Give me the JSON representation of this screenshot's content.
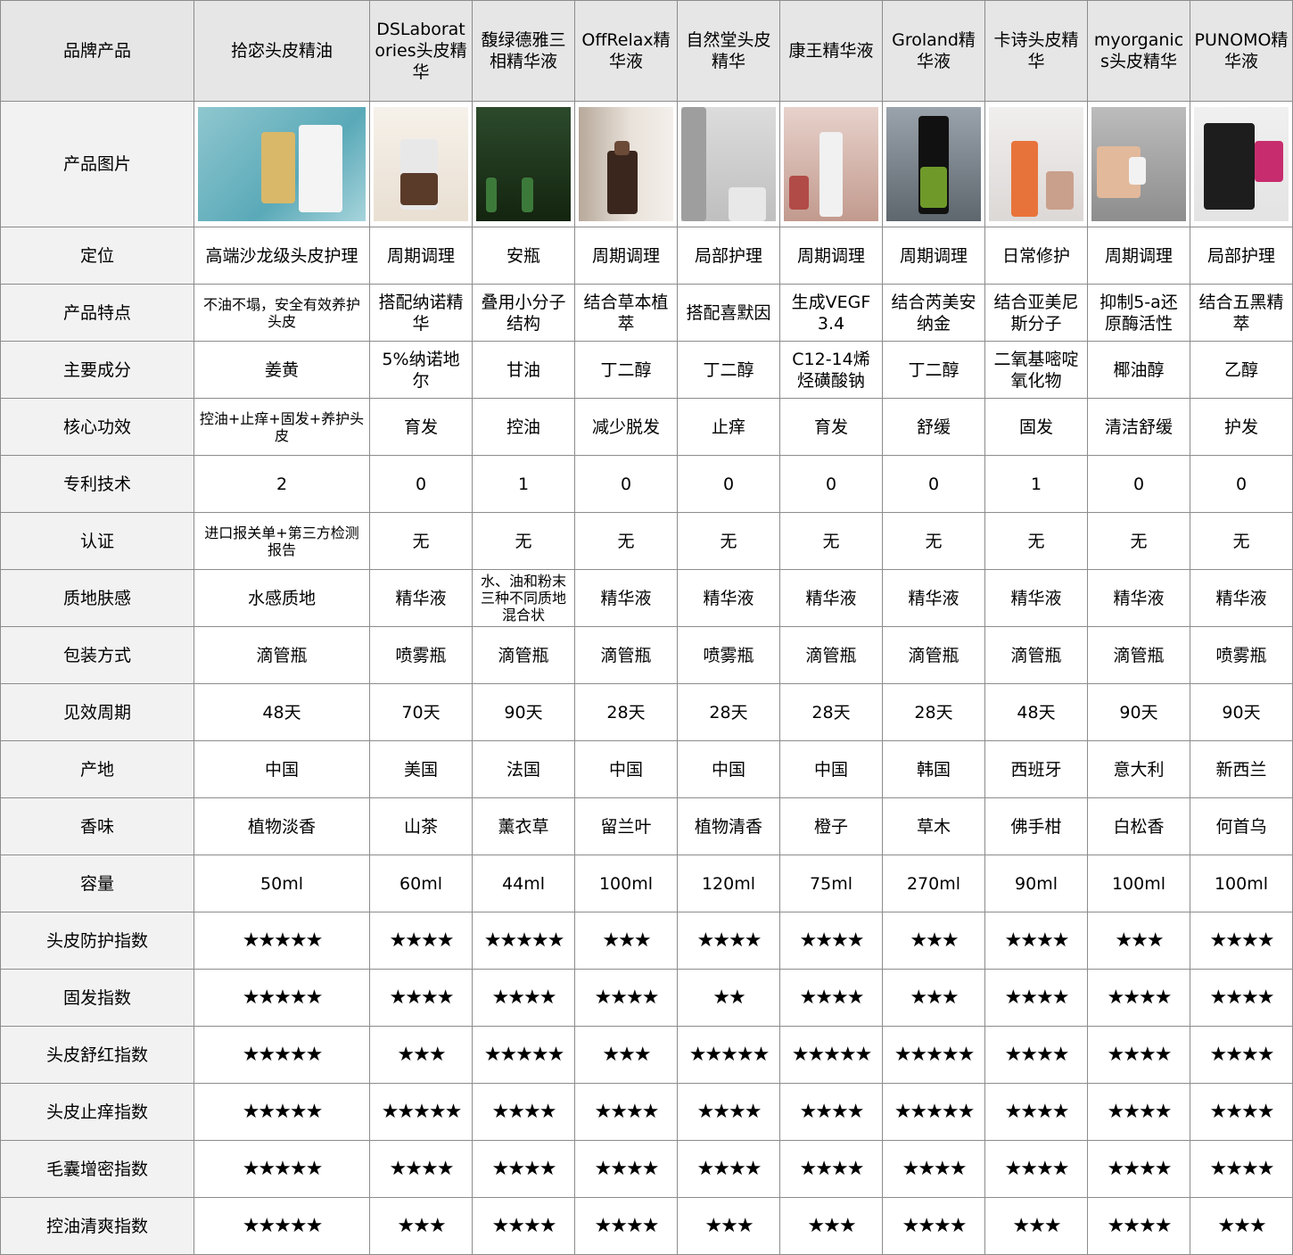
{
  "header": {
    "label": "品牌产品",
    "columns": [
      "拾宓头皮精油",
      "DSLaboratories头皮精华",
      "馥绿德雅三相精华液",
      "OffRelax精华液",
      "自然堂头皮精华",
      "康王精华液",
      "Groland精华液",
      "卡诗头皮精华",
      "myorganics头皮精华",
      "PUNOMO精华液"
    ]
  },
  "image_row": {
    "label": "产品图片",
    "images": [
      "product-photo-1",
      "product-photo-2",
      "product-photo-3",
      "product-photo-4",
      "product-photo-5",
      "product-photo-6",
      "product-photo-7",
      "product-photo-8",
      "product-photo-9",
      "product-photo-10"
    ]
  },
  "rows": [
    {
      "label": "定位",
      "values": [
        "高端沙龙级头皮护理",
        "周期调理",
        "安瓶",
        "周期调理",
        "局部护理",
        "周期调理",
        "周期调理",
        "日常修护",
        "周期调理",
        "局部护理"
      ]
    },
    {
      "label": "产品特点",
      "values": [
        "不油不塌，安全有效养护头皮",
        "搭配纳诺精华",
        "叠用小分子结构",
        "结合草本植萃",
        "搭配喜默因",
        "生成VEGF3.4",
        "结合芮美安纳金",
        "结合亚美尼斯分子",
        "抑制5-a还原酶活性",
        "结合五黑精萃"
      ]
    },
    {
      "label": "主要成分",
      "values": [
        "姜黄",
        "5%纳诺地尔",
        "甘油",
        "丁二醇",
        "丁二醇",
        "C12-14烯烃磺酸钠",
        "丁二醇",
        "二氧基嘧啶氧化物",
        "椰油醇",
        "乙醇"
      ]
    },
    {
      "label": "核心功效",
      "values": [
        "控油+止痒+固发+养护头皮",
        "育发",
        "控油",
        "减少脱发",
        "止痒",
        "育发",
        "舒缓",
        "固发",
        "清洁舒缓",
        "护发"
      ]
    },
    {
      "label": "专利技术",
      "values": [
        "2",
        "0",
        "1",
        "0",
        "0",
        "0",
        "0",
        "1",
        "0",
        "0"
      ]
    },
    {
      "label": "认证",
      "values": [
        "进口报关单+第三方检测报告",
        "无",
        "无",
        "无",
        "无",
        "无",
        "无",
        "无",
        "无",
        "无"
      ]
    },
    {
      "label": "质地肤感",
      "values": [
        "水感质地",
        "精华液",
        "水、油和粉末三种不同质地混合状",
        "精华液",
        "精华液",
        "精华液",
        "精华液",
        "精华液",
        "精华液",
        "精华液"
      ]
    },
    {
      "label": "包装方式",
      "values": [
        "滴管瓶",
        "喷雾瓶",
        "滴管瓶",
        "滴管瓶",
        "喷雾瓶",
        "滴管瓶",
        "滴管瓶",
        "滴管瓶",
        "滴管瓶",
        "喷雾瓶"
      ]
    },
    {
      "label": "见效周期",
      "values": [
        "48天",
        "70天",
        "90天",
        "28天",
        "28天",
        "28天",
        "28天",
        "48天",
        "90天",
        "90天"
      ]
    },
    {
      "label": "产地",
      "values": [
        "中国",
        "美国",
        "法国",
        "中国",
        "中国",
        "中国",
        "韩国",
        "西班牙",
        "意大利",
        "新西兰"
      ]
    },
    {
      "label": "香味",
      "values": [
        "植物淡香",
        "山茶",
        "薰衣草",
        "留兰叶",
        "植物清香",
        "橙子",
        "草木",
        "佛手柑",
        "白松香",
        "何首乌"
      ]
    },
    {
      "label": "容量",
      "values": [
        "50ml",
        "60ml",
        "44ml",
        "100ml",
        "120ml",
        "75ml",
        "270ml",
        "90ml",
        "100ml",
        "100ml"
      ]
    },
    {
      "label": "头皮防护指数",
      "stars": true,
      "values": [
        "★★★★★",
        "★★★★",
        "★★★★★",
        "★★★",
        "★★★★",
        "★★★★",
        "★★★",
        "★★★★",
        "★★★",
        "★★★★"
      ]
    },
    {
      "label": "固发指数",
      "stars": true,
      "values": [
        "★★★★★",
        "★★★★",
        "★★★★",
        "★★★★",
        "★★",
        "★★★★",
        "★★★",
        "★★★★",
        "★★★★",
        "★★★★"
      ]
    },
    {
      "label": "头皮舒红指数",
      "stars": true,
      "values": [
        "★★★★★",
        "★★★",
        "★★★★★",
        "★★★",
        "★★★★★",
        "★★★★★",
        "★★★★★",
        "★★★★",
        "★★★★",
        "★★★★"
      ]
    },
    {
      "label": "头皮止痒指数",
      "stars": true,
      "values": [
        "★★★★★",
        "★★★★★",
        "★★★★",
        "★★★★",
        "★★★★",
        "★★★★",
        "★★★★★",
        "★★★★",
        "★★★★",
        "★★★★"
      ]
    },
    {
      "label": "毛囊增密指数",
      "stars": true,
      "values": [
        "★★★★★",
        "★★★★",
        "★★★★",
        "★★★★",
        "★★★★",
        "★★★★",
        "★★★★",
        "★★★★",
        "★★★★",
        "★★★★"
      ]
    },
    {
      "label": "控油清爽指数",
      "stars": true,
      "values": [
        "★★★★★",
        "★★★",
        "★★★★",
        "★★★★",
        "★★★",
        "★★★",
        "★★★★",
        "★★★",
        "★★★★",
        "★★★"
      ]
    }
  ],
  "colors": {
    "header_bg": "#e6e6e6",
    "label_bg": "#f2f2f2",
    "border": "#8c8c8c"
  }
}
